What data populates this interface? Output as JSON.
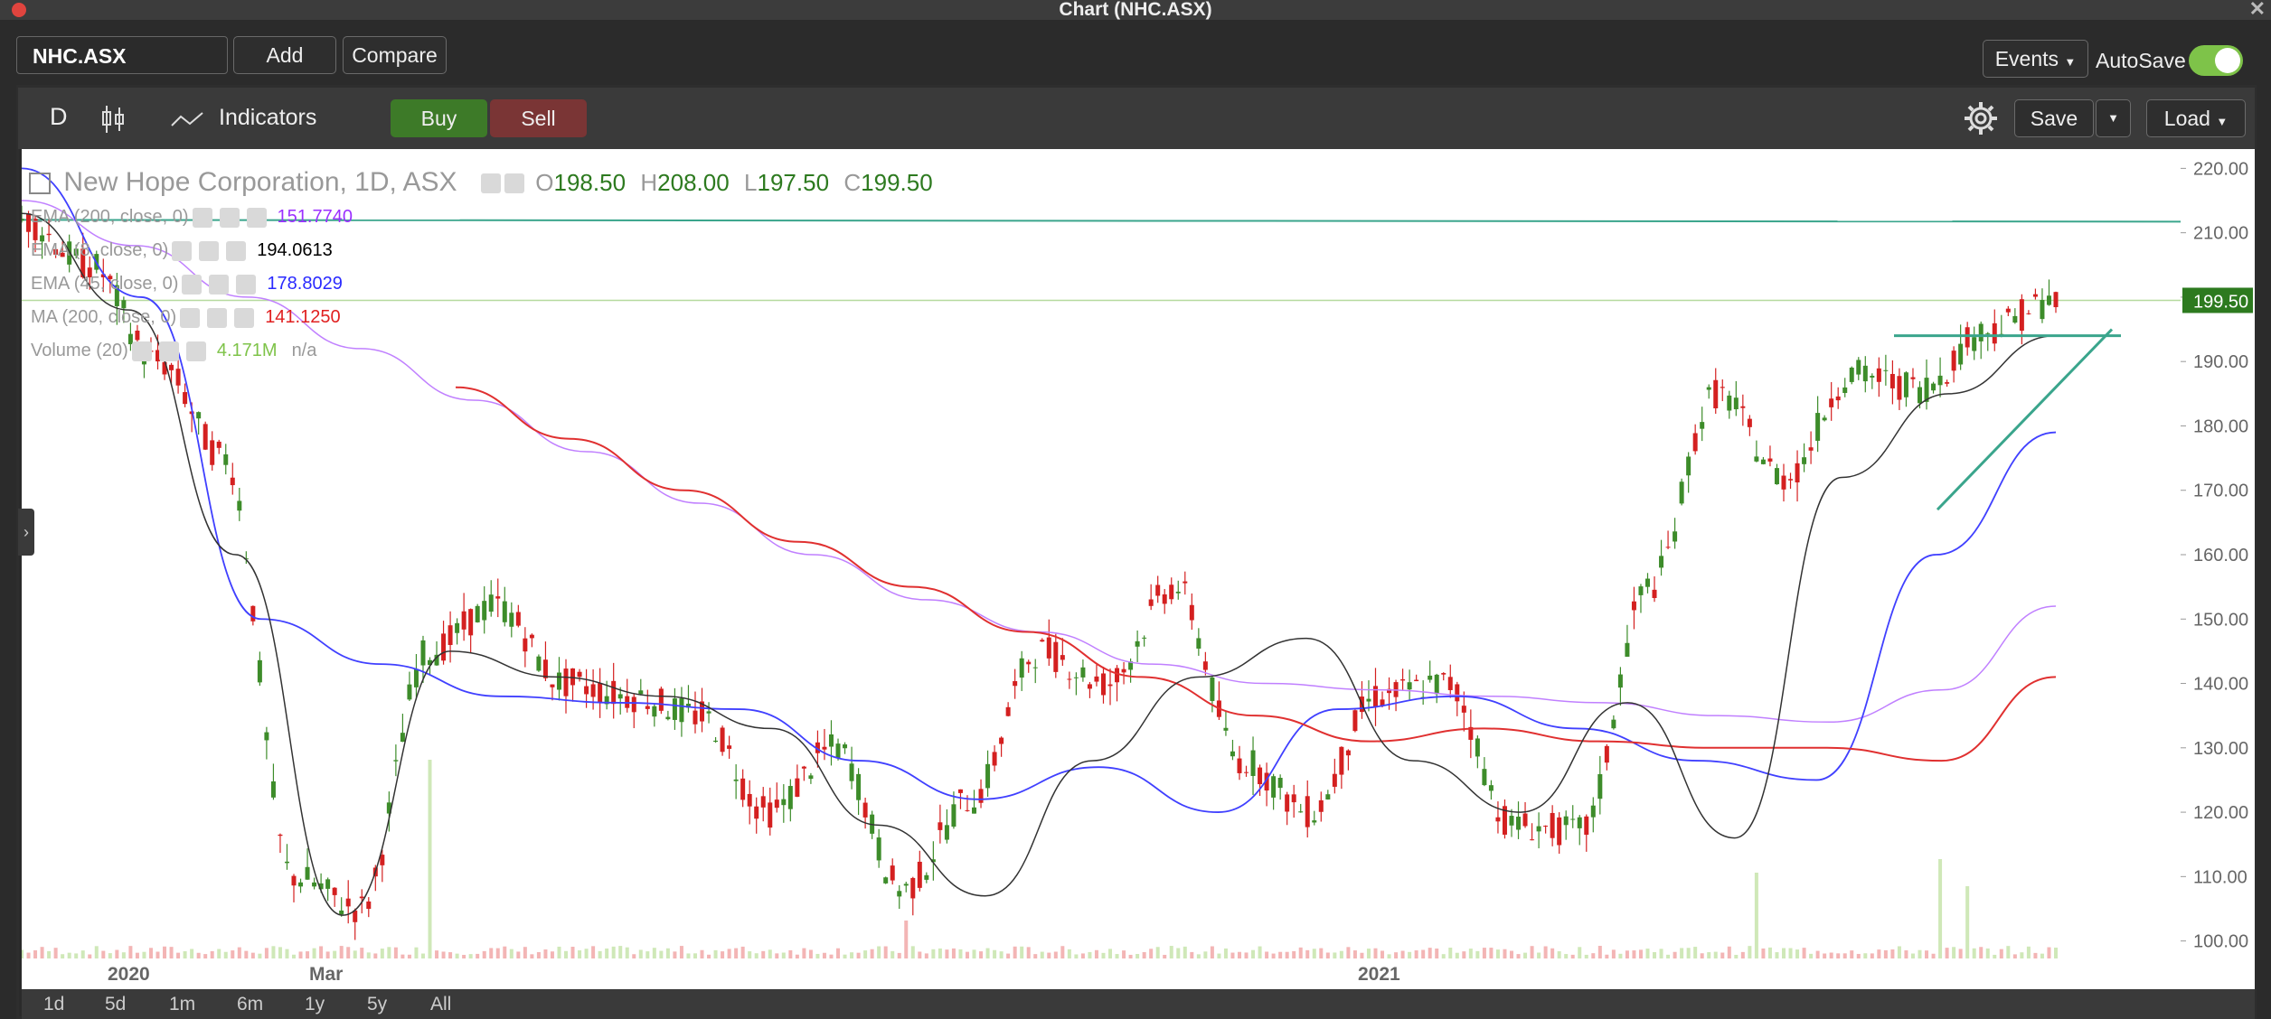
{
  "window": {
    "title": "Chart (NHC.ASX)"
  },
  "toolbar": {
    "symbol": "NHC.ASX",
    "add_label": "Add",
    "compare_label": "Compare",
    "events_label": "Events",
    "autosave_label": "AutoSave",
    "autosave_on": true
  },
  "chart_toolbar": {
    "interval_label": "D",
    "indicators_label": "Indicators",
    "buy_label": "Buy",
    "sell_label": "Sell",
    "save_label": "Save",
    "load_label": "Load"
  },
  "legend": {
    "name": "New Hope Corporation, 1D, ASX",
    "o_label": "O",
    "o_value": "198.50",
    "h_label": "H",
    "h_value": "208.00",
    "l_label": "L",
    "l_value": "197.50",
    "c_label": "C",
    "c_value": "199.50",
    "studies": [
      {
        "label": "EMA (200, close, 0)",
        "value": "151.7740",
        "color": "#9b30ff"
      },
      {
        "label": "EMA (8, close, 0)",
        "value": "194.0613",
        "color": "#000000"
      },
      {
        "label": "EMA (45, close, 0)",
        "value": "178.8029",
        "color": "#2a2aff"
      },
      {
        "label": "MA (200, close, 0)",
        "value": "141.1250",
        "color": "#e02020"
      },
      {
        "label": "Volume (20)",
        "value": "4.171M",
        "value2": "n/a",
        "color": "#7ec349"
      }
    ]
  },
  "price_axis": {
    "ticks": [
      "220.00",
      "210.00",
      "200.00",
      "190.00",
      "180.00",
      "170.00",
      "160.00",
      "150.00",
      "140.00",
      "130.00",
      "120.00",
      "110.00",
      "100.00"
    ],
    "last_price": "199.50"
  },
  "time_axis": {
    "labels": [
      "2020",
      "Mar",
      "2021"
    ]
  },
  "ranges": [
    "1d",
    "5d",
    "1m",
    "6m",
    "1y",
    "5y",
    "All"
  ],
  "colors": {
    "up": "#3d8c2a",
    "down": "#d42020",
    "trendline": "#3aa58c",
    "ema200": "#c080ff",
    "ema45": "#4040ff",
    "ma200": "#e03030",
    "ema8": "#333333"
  },
  "chart_data": {
    "type": "candlestick",
    "symbol": "NHC.ASX",
    "interval": "1D",
    "ylim": [
      97,
      223
    ],
    "x_range": [
      "2019-12",
      "2021-08"
    ],
    "last": {
      "open": 198.5,
      "high": 208.0,
      "low": 197.5,
      "close": 199.5
    },
    "series": [
      {
        "name": "EMA (200, close, 0)",
        "values": [
          215,
          208,
          200,
          192,
          184,
          176,
          168,
          160,
          153,
          148,
          143,
          140,
          139,
          138,
          137,
          135,
          134,
          139,
          152
        ]
      },
      {
        "name": "EMA (45, close, 0)",
        "values": [
          220,
          200,
          150,
          143,
          138,
          137,
          136,
          128,
          122,
          127,
          120,
          136,
          138,
          133,
          128,
          125,
          160,
          179
        ]
      },
      {
        "name": "MA (200, close, 0)",
        "values": [
          186,
          178,
          170,
          162,
          155,
          148,
          141,
          135,
          131,
          133,
          131,
          130,
          130,
          128,
          141
        ]
      },
      {
        "name": "EMA (8, close, 0)",
        "values": [
          213,
          198,
          160,
          104,
          145,
          141,
          138,
          133,
          118,
          107,
          128,
          141,
          147,
          128,
          120,
          137,
          116,
          172,
          185,
          194
        ]
      },
      {
        "name": "Price",
        "values": [
          212,
          205,
          190,
          175,
          110,
          105,
          145,
          152,
          140,
          138,
          135,
          120,
          130,
          108,
          122,
          145,
          140,
          155,
          128,
          120,
          138,
          140,
          118,
          117,
          155,
          185,
          172,
          188,
          186,
          195,
          199.5
        ]
      }
    ],
    "horizontal_lines": [
      212,
      199.5
    ],
    "triangle": {
      "top": 194,
      "bottom_left": 167
    }
  }
}
